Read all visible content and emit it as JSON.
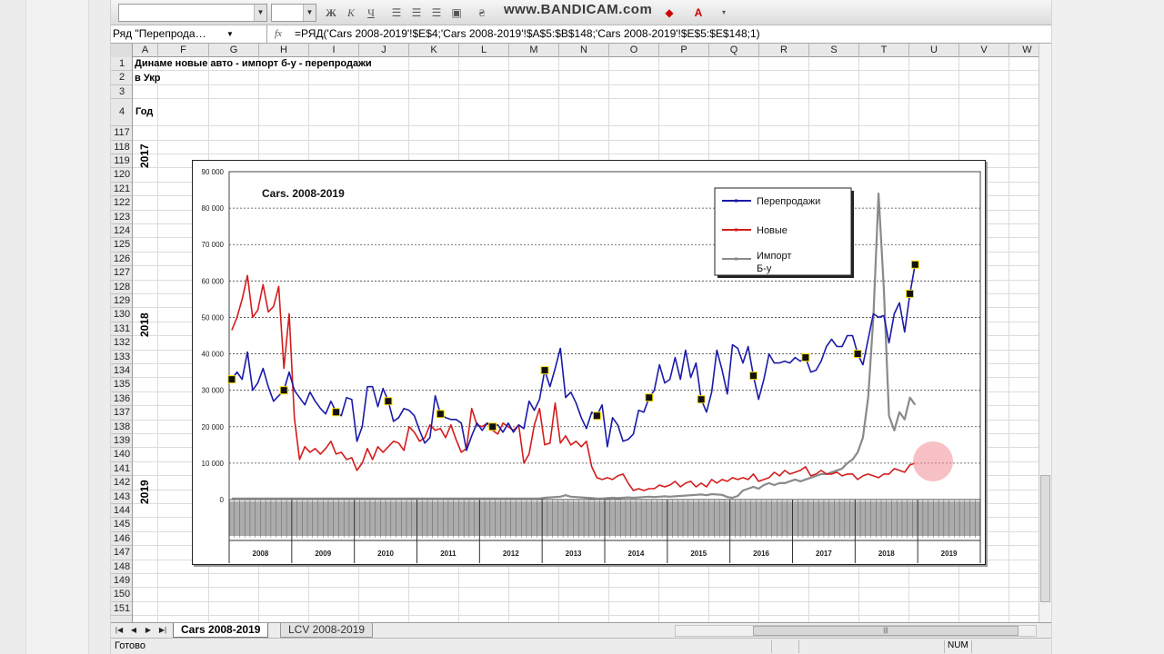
{
  "window": {
    "watermark": "www.BANDICAM.com",
    "name_box": "Ряд \"Перепрода…",
    "fx_label": "fx",
    "formula": "=РЯД('Cars 2008-2019'!$E$4;'Cars 2008-2019'!$A$5:$B$148;'Cars 2008-2019'!$E$5:$E$148;1)"
  },
  "toolbar": {
    "bold": "Ж",
    "italic": "К",
    "underline": "Ч"
  },
  "columns": [
    "A",
    "F",
    "G",
    "H",
    "I",
    "J",
    "K",
    "L",
    "M",
    "N",
    "O",
    "P",
    "Q",
    "R",
    "S",
    "T",
    "U",
    "V",
    "W"
  ],
  "rows": [
    "1",
    "2",
    "3",
    "4",
    "117",
    "118",
    "119",
    "120",
    "121",
    "122",
    "123",
    "124",
    "125",
    "126",
    "127",
    "128",
    "129",
    "130",
    "131",
    "132",
    "133",
    "134",
    "135",
    "136",
    "137",
    "138",
    "139",
    "140",
    "141",
    "142",
    "143",
    "144",
    "145",
    "146",
    "147",
    "148",
    "149",
    "150",
    "151"
  ],
  "cells": {
    "r1": "Динаме новые авто - импорт б-у - перепродажи",
    "r2": "в Укр",
    "r4": "Год",
    "year_2017": "2017",
    "year_2018": "2018",
    "year_2019": "2019"
  },
  "sheets": [
    {
      "label": "Cars 2008-2019",
      "active": true
    },
    {
      "label": "LCV 2008-2019",
      "active": false
    }
  ],
  "status": {
    "ready": "Готово",
    "num": "NUM"
  },
  "chart_data": {
    "type": "line",
    "title": "Cars. 2008-2019",
    "xlabel": "",
    "ylabel": "",
    "ylim": [
      0,
      90000
    ],
    "yticks": [
      "0",
      "10 000",
      "20 000",
      "30 000",
      "40 000",
      "50 000",
      "60 000",
      "70 000",
      "80 000",
      "90 000"
    ],
    "years": [
      "2008",
      "2009",
      "2010",
      "2011",
      "2012",
      "2013",
      "2014",
      "2015",
      "2016",
      "2017",
      "2018",
      "2019"
    ],
    "months_per_year": 12,
    "legend_position": "top-right",
    "grid": "horizontal dashed",
    "series": [
      {
        "name": "Перепродажи",
        "color": "#1a1aa8",
        "values": [
          33000,
          35000,
          33000,
          40500,
          30000,
          32000,
          36000,
          31000,
          27000,
          28500,
          30000,
          35000,
          30000,
          28000,
          26000,
          29500,
          27000,
          25000,
          23500,
          27000,
          24000,
          23000,
          28000,
          27500,
          16000,
          20000,
          31000,
          31000,
          25500,
          30500,
          27000,
          21500,
          22500,
          25000,
          24500,
          23000,
          19000,
          15500,
          17000,
          28500,
          23500,
          22500,
          22000,
          22000,
          21000,
          13500,
          17500,
          21000,
          19000,
          21000,
          20000,
          20500,
          18500,
          21000,
          18500,
          20500,
          19500,
          27000,
          24500,
          27500,
          35500,
          31000,
          36000,
          41500,
          28000,
          29500,
          26500,
          22500,
          19500,
          24000,
          23000,
          26000,
          14500,
          22500,
          20500,
          16000,
          16500,
          18000,
          24500,
          24000,
          28000,
          30000,
          37000,
          32000,
          33000,
          39000,
          33000,
          41000,
          33500,
          37500,
          27500,
          24000,
          29500,
          41000,
          35500,
          29000,
          42500,
          41500,
          37500,
          42000,
          34000,
          27500,
          33000,
          40000,
          37500,
          37500,
          38000,
          37500,
          39000,
          38000,
          39000,
          35000,
          35500,
          38000,
          42000,
          44000,
          42000,
          42000,
          45000,
          45000,
          40000,
          37000,
          44000,
          51000,
          50000,
          50500,
          43000,
          51000,
          54000,
          46000,
          56500,
          64500
        ]
      },
      {
        "name": "Новые",
        "color": "#d41c1c",
        "values": [
          46500,
          50000,
          55000,
          61500,
          50000,
          52000,
          59000,
          51500,
          53000,
          58500,
          36000,
          51000,
          22500,
          11000,
          14500,
          13000,
          14000,
          12500,
          14000,
          16000,
          12500,
          13000,
          11000,
          11500,
          8000,
          10000,
          14000,
          11000,
          14500,
          13000,
          14500,
          16000,
          15500,
          13500,
          20000,
          18500,
          16000,
          17000,
          20500,
          19000,
          19500,
          17000,
          20500,
          16500,
          13000,
          14000,
          25000,
          20500,
          20000,
          21000,
          19000,
          18000,
          21000,
          20000,
          19000,
          20500,
          10000,
          12500,
          20500,
          25000,
          15000,
          15500,
          26500,
          15500,
          17500,
          15000,
          16000,
          14500,
          16000,
          9000,
          6000,
          5500,
          6000,
          5500,
          6500,
          7000,
          4500,
          2500,
          3000,
          2500,
          3000,
          3000,
          4000,
          3500,
          4000,
          5000,
          3500,
          4500,
          5000,
          3500,
          4500,
          3500,
          5500,
          4500,
          5500,
          5000,
          6000,
          5500,
          6000,
          5500,
          7000,
          5000,
          5500,
          6000,
          7500,
          6500,
          8000,
          7000,
          7500,
          8000,
          9000,
          6500,
          7000,
          8000,
          7000,
          7000,
          7500,
          6500,
          7000,
          7000,
          5500,
          6500,
          7000,
          6500,
          6000,
          7000,
          7000,
          8500,
          8000,
          7500,
          9500,
          10000
        ]
      },
      {
        "name": "Импорт Б-у",
        "color": "#8a8a8a",
        "values": [
          300,
          300,
          300,
          300,
          300,
          300,
          300,
          300,
          300,
          300,
          300,
          300,
          300,
          300,
          300,
          300,
          300,
          300,
          300,
          300,
          300,
          300,
          300,
          300,
          300,
          300,
          300,
          300,
          300,
          300,
          300,
          300,
          300,
          300,
          300,
          300,
          300,
          300,
          300,
          300,
          300,
          300,
          300,
          300,
          300,
          300,
          300,
          300,
          300,
          300,
          300,
          300,
          300,
          300,
          300,
          300,
          300,
          300,
          300,
          300,
          500,
          600,
          700,
          800,
          1200,
          800,
          700,
          600,
          500,
          400,
          300,
          300,
          400,
          500,
          400,
          500,
          600,
          500,
          600,
          700,
          800,
          700,
          800,
          900,
          800,
          900,
          1000,
          1100,
          1200,
          1300,
          1400,
          1200,
          1500,
          1400,
          1300,
          700,
          500,
          1000,
          2500,
          3000,
          3500,
          3000,
          4000,
          4500,
          4000,
          4500,
          4500,
          5000,
          5500,
          5000,
          5500,
          6000,
          6500,
          7000,
          7000,
          7500,
          8000,
          8500,
          10000,
          11000,
          13000,
          17000,
          28000,
          50000,
          84000,
          58000,
          23000,
          19000,
          24000,
          22000,
          28000,
          26000
        ]
      }
    ]
  }
}
